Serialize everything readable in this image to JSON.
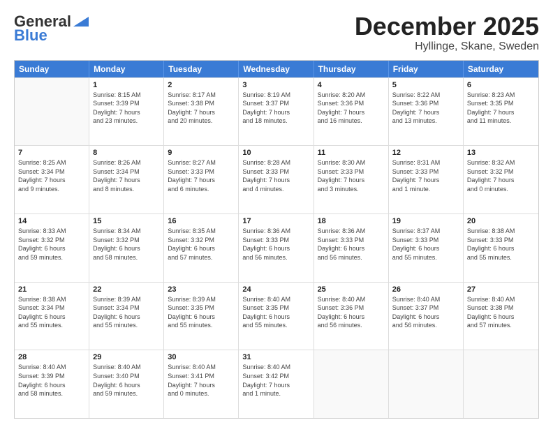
{
  "header": {
    "logo_general": "General",
    "logo_blue": "Blue",
    "month": "December 2025",
    "location": "Hyllinge, Skane, Sweden"
  },
  "weekdays": [
    "Sunday",
    "Monday",
    "Tuesday",
    "Wednesday",
    "Thursday",
    "Friday",
    "Saturday"
  ],
  "weeks": [
    [
      {
        "day": "",
        "info": ""
      },
      {
        "day": "1",
        "info": "Sunrise: 8:15 AM\nSunset: 3:39 PM\nDaylight: 7 hours\nand 23 minutes."
      },
      {
        "day": "2",
        "info": "Sunrise: 8:17 AM\nSunset: 3:38 PM\nDaylight: 7 hours\nand 20 minutes."
      },
      {
        "day": "3",
        "info": "Sunrise: 8:19 AM\nSunset: 3:37 PM\nDaylight: 7 hours\nand 18 minutes."
      },
      {
        "day": "4",
        "info": "Sunrise: 8:20 AM\nSunset: 3:36 PM\nDaylight: 7 hours\nand 16 minutes."
      },
      {
        "day": "5",
        "info": "Sunrise: 8:22 AM\nSunset: 3:36 PM\nDaylight: 7 hours\nand 13 minutes."
      },
      {
        "day": "6",
        "info": "Sunrise: 8:23 AM\nSunset: 3:35 PM\nDaylight: 7 hours\nand 11 minutes."
      }
    ],
    [
      {
        "day": "7",
        "info": "Sunrise: 8:25 AM\nSunset: 3:34 PM\nDaylight: 7 hours\nand 9 minutes."
      },
      {
        "day": "8",
        "info": "Sunrise: 8:26 AM\nSunset: 3:34 PM\nDaylight: 7 hours\nand 8 minutes."
      },
      {
        "day": "9",
        "info": "Sunrise: 8:27 AM\nSunset: 3:33 PM\nDaylight: 7 hours\nand 6 minutes."
      },
      {
        "day": "10",
        "info": "Sunrise: 8:28 AM\nSunset: 3:33 PM\nDaylight: 7 hours\nand 4 minutes."
      },
      {
        "day": "11",
        "info": "Sunrise: 8:30 AM\nSunset: 3:33 PM\nDaylight: 7 hours\nand 3 minutes."
      },
      {
        "day": "12",
        "info": "Sunrise: 8:31 AM\nSunset: 3:33 PM\nDaylight: 7 hours\nand 1 minute."
      },
      {
        "day": "13",
        "info": "Sunrise: 8:32 AM\nSunset: 3:32 PM\nDaylight: 7 hours\nand 0 minutes."
      }
    ],
    [
      {
        "day": "14",
        "info": "Sunrise: 8:33 AM\nSunset: 3:32 PM\nDaylight: 6 hours\nand 59 minutes."
      },
      {
        "day": "15",
        "info": "Sunrise: 8:34 AM\nSunset: 3:32 PM\nDaylight: 6 hours\nand 58 minutes."
      },
      {
        "day": "16",
        "info": "Sunrise: 8:35 AM\nSunset: 3:32 PM\nDaylight: 6 hours\nand 57 minutes."
      },
      {
        "day": "17",
        "info": "Sunrise: 8:36 AM\nSunset: 3:33 PM\nDaylight: 6 hours\nand 56 minutes."
      },
      {
        "day": "18",
        "info": "Sunrise: 8:36 AM\nSunset: 3:33 PM\nDaylight: 6 hours\nand 56 minutes."
      },
      {
        "day": "19",
        "info": "Sunrise: 8:37 AM\nSunset: 3:33 PM\nDaylight: 6 hours\nand 55 minutes."
      },
      {
        "day": "20",
        "info": "Sunrise: 8:38 AM\nSunset: 3:33 PM\nDaylight: 6 hours\nand 55 minutes."
      }
    ],
    [
      {
        "day": "21",
        "info": "Sunrise: 8:38 AM\nSunset: 3:34 PM\nDaylight: 6 hours\nand 55 minutes."
      },
      {
        "day": "22",
        "info": "Sunrise: 8:39 AM\nSunset: 3:34 PM\nDaylight: 6 hours\nand 55 minutes."
      },
      {
        "day": "23",
        "info": "Sunrise: 8:39 AM\nSunset: 3:35 PM\nDaylight: 6 hours\nand 55 minutes."
      },
      {
        "day": "24",
        "info": "Sunrise: 8:40 AM\nSunset: 3:35 PM\nDaylight: 6 hours\nand 55 minutes."
      },
      {
        "day": "25",
        "info": "Sunrise: 8:40 AM\nSunset: 3:36 PM\nDaylight: 6 hours\nand 56 minutes."
      },
      {
        "day": "26",
        "info": "Sunrise: 8:40 AM\nSunset: 3:37 PM\nDaylight: 6 hours\nand 56 minutes."
      },
      {
        "day": "27",
        "info": "Sunrise: 8:40 AM\nSunset: 3:38 PM\nDaylight: 6 hours\nand 57 minutes."
      }
    ],
    [
      {
        "day": "28",
        "info": "Sunrise: 8:40 AM\nSunset: 3:39 PM\nDaylight: 6 hours\nand 58 minutes."
      },
      {
        "day": "29",
        "info": "Sunrise: 8:40 AM\nSunset: 3:40 PM\nDaylight: 6 hours\nand 59 minutes."
      },
      {
        "day": "30",
        "info": "Sunrise: 8:40 AM\nSunset: 3:41 PM\nDaylight: 7 hours\nand 0 minutes."
      },
      {
        "day": "31",
        "info": "Sunrise: 8:40 AM\nSunset: 3:42 PM\nDaylight: 7 hours\nand 1 minute."
      },
      {
        "day": "",
        "info": ""
      },
      {
        "day": "",
        "info": ""
      },
      {
        "day": "",
        "info": ""
      }
    ]
  ]
}
